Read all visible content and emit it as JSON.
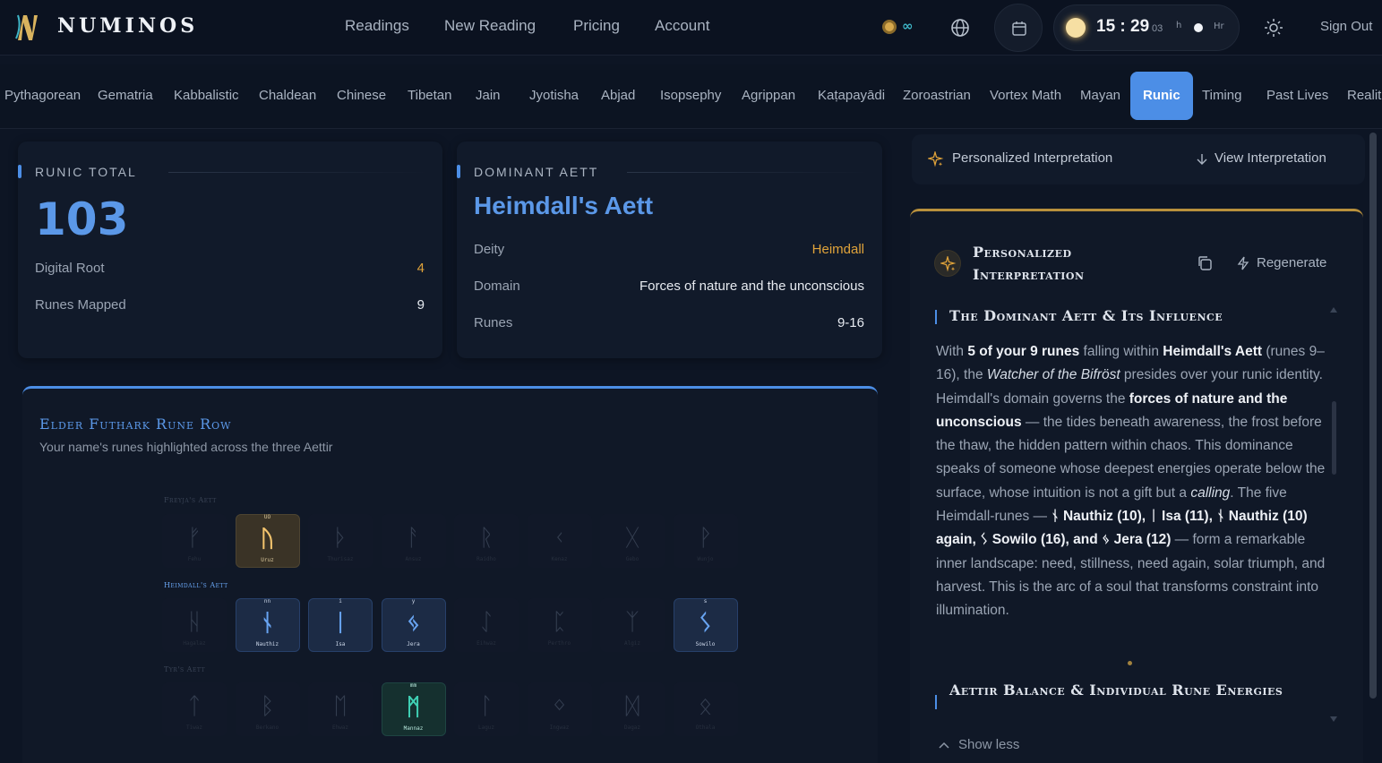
{
  "brand": {
    "name": "NUMINOS"
  },
  "nav": {
    "links": [
      "Readings",
      "New Reading",
      "Pricing",
      "Account"
    ],
    "credits": "∞",
    "clock": {
      "time": "15 : 29",
      "seconds": "03",
      "mode_12": "h",
      "mode_24": "Hr"
    },
    "sign_out": "Sign Out"
  },
  "systems": [
    "Pythagorean",
    "Gematria",
    "Kabbalistic",
    "Chaldean",
    "Chinese",
    "Tibetan",
    "Jain",
    "Jyotisha",
    "Abjad",
    "Isopsephy",
    "Agrippan",
    "Kaṭapayādi",
    "Zoroastrian",
    "Vortex Math",
    "Mayan",
    "Runic",
    "Timing",
    "Past Lives",
    "Realit"
  ],
  "active_system": "Runic",
  "runic_total": {
    "heading": "RUNIC TOTAL",
    "value": "103",
    "rows": [
      {
        "label": "Digital Root",
        "value": "4",
        "color": "#e0a33a"
      },
      {
        "label": "Runes Mapped",
        "value": "9",
        "color": "#e6eaf0"
      }
    ]
  },
  "dominant_aett": {
    "heading": "DOMINANT AETT",
    "title": "Heimdall's Aett",
    "rows": [
      {
        "label": "Deity",
        "value": "Heimdall",
        "color": "#e0a33a"
      },
      {
        "label": "Domain",
        "value": "Forces of nature and the unconscious",
        "color": "#e6eaf0"
      },
      {
        "label": "Runes",
        "value": "9-16",
        "color": "#e6eaf0"
      }
    ]
  },
  "rune_row": {
    "title": "Elder Futhark Rune Row",
    "subtitle": "Your name's runes highlighted across the three Aettir",
    "aettir": [
      {
        "label": "Freyja's Aett",
        "color": "#3a4456",
        "runes": [
          {
            "glyph": "ᚠ",
            "name": "Fehu",
            "state": "dim",
            "tag": ""
          },
          {
            "glyph": "ᚢ",
            "name": "Uruz",
            "state": "gold",
            "tag": "UO"
          },
          {
            "glyph": "ᚦ",
            "name": "Thurisaz",
            "state": "dim",
            "tag": ""
          },
          {
            "glyph": "ᚨ",
            "name": "Ansuz",
            "state": "dim",
            "tag": ""
          },
          {
            "glyph": "ᚱ",
            "name": "Raidho",
            "state": "dim",
            "tag": ""
          },
          {
            "glyph": "ᚲ",
            "name": "Kenaz",
            "state": "dim",
            "tag": ""
          },
          {
            "glyph": "ᚷ",
            "name": "Gebo",
            "state": "dim",
            "tag": ""
          },
          {
            "glyph": "ᚹ",
            "name": "Wunjo",
            "state": "dim",
            "tag": ""
          }
        ]
      },
      {
        "label": "Heimdall's Aett",
        "color": "#68a4f2",
        "runes": [
          {
            "glyph": "ᚺ",
            "name": "Hagalaz",
            "state": "dim",
            "tag": ""
          },
          {
            "glyph": "ᚾ",
            "name": "Nauthiz",
            "state": "blue",
            "tag": "nn"
          },
          {
            "glyph": "ᛁ",
            "name": "Isa",
            "state": "blue",
            "tag": "i"
          },
          {
            "glyph": "ᛃ",
            "name": "Jera",
            "state": "blue",
            "tag": "y"
          },
          {
            "glyph": "ᛇ",
            "name": "Eihwaz",
            "state": "dim",
            "tag": ""
          },
          {
            "glyph": "ᛈ",
            "name": "Perthro",
            "state": "dim",
            "tag": ""
          },
          {
            "glyph": "ᛉ",
            "name": "Algiz",
            "state": "dim",
            "tag": ""
          },
          {
            "glyph": "ᛊ",
            "name": "Sowilo",
            "state": "blue",
            "tag": "s"
          }
        ]
      },
      {
        "label": "Tyr's Aett",
        "color": "#3a4456",
        "runes": [
          {
            "glyph": "ᛏ",
            "name": "Tiwaz",
            "state": "dim",
            "tag": ""
          },
          {
            "glyph": "ᛒ",
            "name": "Berkano",
            "state": "dim",
            "tag": ""
          },
          {
            "glyph": "ᛖ",
            "name": "Ehwaz",
            "state": "dim",
            "tag": ""
          },
          {
            "glyph": "ᛗ",
            "name": "Mannaz",
            "state": "teal",
            "tag": "mm"
          },
          {
            "glyph": "ᛚ",
            "name": "Laguz",
            "state": "dim",
            "tag": ""
          },
          {
            "glyph": "ᛜ",
            "name": "Ingwaz",
            "state": "dim",
            "tag": ""
          },
          {
            "glyph": "ᛞ",
            "name": "Dagaz",
            "state": "dim",
            "tag": ""
          },
          {
            "glyph": "ᛟ",
            "name": "Othala",
            "state": "dim",
            "tag": ""
          }
        ]
      }
    ]
  },
  "interpretation": {
    "bar_label": "Personalized Interpretation",
    "view_label": "View Interpretation",
    "panel_title": "Personalized Interpretation",
    "regenerate": "Regenerate",
    "section1_title": "The Dominant Aett & Its Influence",
    "paragraph": [
      {
        "t": "With ",
        "s": "n"
      },
      {
        "t": "5 of your 9 runes",
        "s": "b"
      },
      {
        "t": " falling within ",
        "s": "n"
      },
      {
        "t": "Heimdall's Aett",
        "s": "b"
      },
      {
        "t": " (runes 9–16), the ",
        "s": "n"
      },
      {
        "t": "Watcher of the Bifröst",
        "s": "i"
      },
      {
        "t": " presides over your runic identity. Heimdall's domain governs the ",
        "s": "n"
      },
      {
        "t": "forces of nature and the unconscious",
        "s": "b"
      },
      {
        "t": " — the tides beneath awareness, the frost before the thaw, the hidden pattern within chaos. This dominance speaks of someone whose deepest energies operate below the surface, whose intuition is not a gift but a ",
        "s": "n"
      },
      {
        "t": "calling",
        "s": "i"
      },
      {
        "t": ". The five Heimdall-runes — ",
        "s": "n"
      },
      {
        "t": "ᚾ Nauthiz (10), ᛁ Isa (11), ᚾ Nauthiz (10) again, ᛊ Sowilo (16), and ᛃ Jera (12)",
        "s": "b"
      },
      {
        "t": " — form a remarkable inner landscape: need, stillness, need again, solar triumph, and harvest. This is the arc of a soul that transforms constraint into illumination.",
        "s": "n"
      }
    ],
    "section2_title": "Aettir Balance & Individual Rune Energies",
    "show_less": "Show less"
  }
}
